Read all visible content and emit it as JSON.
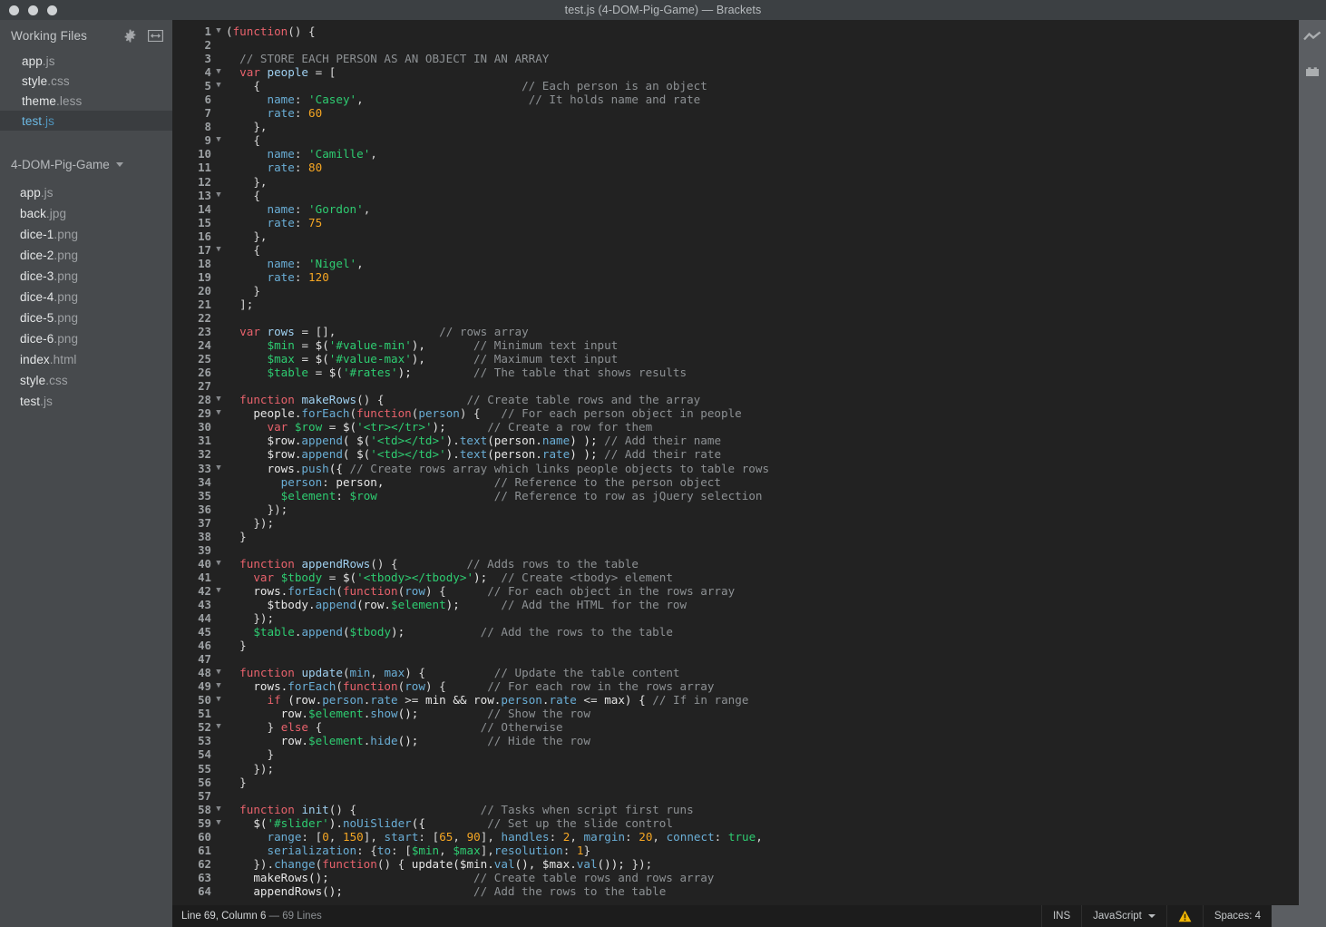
{
  "window": {
    "title": "test.js (4-DOM-Pig-Game) — Brackets",
    "traffic_lights": [
      "close",
      "minimize",
      "maximize"
    ]
  },
  "sidebar": {
    "working_files": {
      "title": "Working Files",
      "gear_icon": "gear-icon",
      "split_icon": "split-view-icon",
      "items": [
        {
          "base": "app",
          "ext": ".js",
          "active": false
        },
        {
          "base": "style",
          "ext": ".css",
          "active": false
        },
        {
          "base": "theme",
          "ext": ".less",
          "active": false
        },
        {
          "base": "test",
          "ext": ".js",
          "active": true
        }
      ]
    },
    "project": {
      "name": "4-DOM-Pig-Game",
      "items": [
        {
          "base": "app",
          "ext": ".js"
        },
        {
          "base": "back",
          "ext": ".jpg"
        },
        {
          "base": "dice-1",
          "ext": ".png"
        },
        {
          "base": "dice-2",
          "ext": ".png"
        },
        {
          "base": "dice-3",
          "ext": ".png"
        },
        {
          "base": "dice-4",
          "ext": ".png"
        },
        {
          "base": "dice-5",
          "ext": ".png"
        },
        {
          "base": "dice-6",
          "ext": ".png"
        },
        {
          "base": "index",
          "ext": ".html"
        },
        {
          "base": "style",
          "ext": ".css"
        },
        {
          "base": "test",
          "ext": ".js"
        }
      ]
    }
  },
  "right_toolbar": {
    "items": [
      {
        "icon": "live-preview-icon"
      },
      {
        "icon": "extension-manager-icon"
      }
    ]
  },
  "statusbar": {
    "cursor": "Line 69, Column 6",
    "lines": "— 69 Lines",
    "insert_mode": "INS",
    "language": "JavaScript",
    "problems_icon": "warning-triangle-icon",
    "indent": "Spaces: 4"
  },
  "colors": {
    "titlebar": "#3c4043",
    "sidebar": "#474a4d",
    "editor_bg": "#222222",
    "statusbar": "#1c1c1c",
    "toolbar": "#5b5e62",
    "accent_active_file": "#6cb9e3",
    "keyword": "#e8626c",
    "string": "#2ecc71",
    "number": "#f5a623",
    "comment": "#8d9194",
    "variable": "#6aaed6",
    "warning": "#f2b705"
  },
  "editor": {
    "filename": "test.js",
    "language": "javascript",
    "lines": [
      {
        "n": 1,
        "fold": true,
        "html": "<span class=\"pun\">(</span><span class=\"kw\">function</span><span class=\"pun\">() {</span>"
      },
      {
        "n": 2,
        "fold": false,
        "html": ""
      },
      {
        "n": 3,
        "fold": false,
        "html": "  <span class=\"com\">// STORE EACH PERSON AS AN OBJECT IN AN ARRAY</span>"
      },
      {
        "n": 4,
        "fold": true,
        "html": "  <span class=\"kw\">var</span> <span class=\"def\">people</span> <span class=\"pun\">= [</span>"
      },
      {
        "n": 5,
        "fold": true,
        "html": "    <span class=\"pun\">{</span>                                      <span class=\"com\">// Each person is an object</span>"
      },
      {
        "n": 6,
        "fold": false,
        "html": "      <span class=\"prop\">name</span><span class=\"pun\">:</span> <span class=\"str\">'Casey'</span><span class=\"pun\">,</span>                        <span class=\"com\">// It holds name and rate</span>"
      },
      {
        "n": 7,
        "fold": false,
        "html": "      <span class=\"prop\">rate</span><span class=\"pun\">:</span> <span class=\"num\">60</span>"
      },
      {
        "n": 8,
        "fold": false,
        "html": "    <span class=\"pun\">},</span>"
      },
      {
        "n": 9,
        "fold": true,
        "html": "    <span class=\"pun\">{</span>"
      },
      {
        "n": 10,
        "fold": false,
        "html": "      <span class=\"prop\">name</span><span class=\"pun\">:</span> <span class=\"str\">'Camille'</span><span class=\"pun\">,</span>"
      },
      {
        "n": 11,
        "fold": false,
        "html": "      <span class=\"prop\">rate</span><span class=\"pun\">:</span> <span class=\"num\">80</span>"
      },
      {
        "n": 12,
        "fold": false,
        "html": "    <span class=\"pun\">},</span>"
      },
      {
        "n": 13,
        "fold": true,
        "html": "    <span class=\"pun\">{</span>"
      },
      {
        "n": 14,
        "fold": false,
        "html": "      <span class=\"prop\">name</span><span class=\"pun\">:</span> <span class=\"str\">'Gordon'</span><span class=\"pun\">,</span>"
      },
      {
        "n": 15,
        "fold": false,
        "html": "      <span class=\"prop\">rate</span><span class=\"pun\">:</span> <span class=\"num\">75</span>"
      },
      {
        "n": 16,
        "fold": false,
        "html": "    <span class=\"pun\">},</span>"
      },
      {
        "n": 17,
        "fold": true,
        "html": "    <span class=\"pun\">{</span>"
      },
      {
        "n": 18,
        "fold": false,
        "html": "      <span class=\"prop\">name</span><span class=\"pun\">:</span> <span class=\"str\">'Nigel'</span><span class=\"pun\">,</span>"
      },
      {
        "n": 19,
        "fold": false,
        "html": "      <span class=\"prop\">rate</span><span class=\"pun\">:</span> <span class=\"num\">120</span>"
      },
      {
        "n": 20,
        "fold": false,
        "html": "    <span class=\"pun\">}</span>"
      },
      {
        "n": 21,
        "fold": false,
        "html": "  <span class=\"pun\">];</span>"
      },
      {
        "n": 22,
        "fold": false,
        "html": ""
      },
      {
        "n": 23,
        "fold": false,
        "html": "  <span class=\"kw\">var</span> <span class=\"def\">rows</span> <span class=\"pun\">= [],</span>               <span class=\"com\">// rows array</span>"
      },
      {
        "n": 24,
        "fold": false,
        "html": "      <span class=\"str\">$min</span> <span class=\"pun\">=</span> <span class=\"plain\">$(</span><span class=\"str\">'#value-min'</span><span class=\"plain\">),</span>       <span class=\"com\">// Minimum text input</span>"
      },
      {
        "n": 25,
        "fold": false,
        "html": "      <span class=\"str\">$max</span> <span class=\"pun\">=</span> <span class=\"plain\">$(</span><span class=\"str\">'#value-max'</span><span class=\"plain\">),</span>       <span class=\"com\">// Maximum text input</span>"
      },
      {
        "n": 26,
        "fold": false,
        "html": "      <span class=\"str\">$table</span> <span class=\"pun\">=</span> <span class=\"plain\">$(</span><span class=\"str\">'#rates'</span><span class=\"plain\">);</span>         <span class=\"com\">// The table that shows results</span>"
      },
      {
        "n": 27,
        "fold": false,
        "html": ""
      },
      {
        "n": 28,
        "fold": true,
        "html": "  <span class=\"kw\">function</span> <span class=\"def\">makeRows</span><span class=\"pun\">() {</span>            <span class=\"com\">// Create table rows and the array</span>"
      },
      {
        "n": 29,
        "fold": true,
        "html": "    <span class=\"plain\">people.</span><span class=\"var\">forEach</span><span class=\"pun\">(</span><span class=\"kw\">function</span><span class=\"pun\">(</span><span class=\"var\">person</span><span class=\"pun\">) {</span>   <span class=\"com\">// For each person object in people</span>"
      },
      {
        "n": 30,
        "fold": false,
        "html": "      <span class=\"kw\">var</span> <span class=\"str\">$row</span> <span class=\"pun\">=</span> <span class=\"plain\">$(</span><span class=\"str\">'&lt;tr&gt;&lt;/tr&gt;'</span><span class=\"plain\">);</span>      <span class=\"com\">// Create a row for them</span>"
      },
      {
        "n": 31,
        "fold": false,
        "html": "      <span class=\"plain\">$row.</span><span class=\"var\">append</span><span class=\"plain\">( $(</span><span class=\"str\">'&lt;td&gt;&lt;/td&gt;'</span><span class=\"plain\">).</span><span class=\"var\">text</span><span class=\"plain\">(person.</span><span class=\"var\">name</span><span class=\"plain\">) );</span> <span class=\"com\">// Add their name</span>"
      },
      {
        "n": 32,
        "fold": false,
        "html": "      <span class=\"plain\">$row.</span><span class=\"var\">append</span><span class=\"plain\">( $(</span><span class=\"str\">'&lt;td&gt;&lt;/td&gt;'</span><span class=\"plain\">).</span><span class=\"var\">text</span><span class=\"plain\">(person.</span><span class=\"var\">rate</span><span class=\"plain\">) );</span> <span class=\"com\">// Add their rate</span>"
      },
      {
        "n": 33,
        "fold": true,
        "html": "      <span class=\"plain\">rows.</span><span class=\"var\">push</span><span class=\"plain\">({</span> <span class=\"com\">// Create rows array which links people objects to table rows</span>"
      },
      {
        "n": 34,
        "fold": false,
        "html": "        <span class=\"prop\">person</span><span class=\"pun\">:</span> <span class=\"plain\">person,</span>                <span class=\"com\">// Reference to the person object</span>"
      },
      {
        "n": 35,
        "fold": false,
        "html": "        <span class=\"str\">$element</span><span class=\"pun\">:</span> <span class=\"str\">$row</span>                 <span class=\"com\">// Reference to row as jQuery selection</span>"
      },
      {
        "n": 36,
        "fold": false,
        "html": "      <span class=\"pun\">});</span>"
      },
      {
        "n": 37,
        "fold": false,
        "html": "    <span class=\"pun\">});</span>"
      },
      {
        "n": 38,
        "fold": false,
        "html": "  <span class=\"pun\">}</span>"
      },
      {
        "n": 39,
        "fold": false,
        "html": ""
      },
      {
        "n": 40,
        "fold": true,
        "html": "  <span class=\"kw\">function</span> <span class=\"def\">appendRows</span><span class=\"pun\">() {</span>          <span class=\"com\">// Adds rows to the table</span>"
      },
      {
        "n": 41,
        "fold": false,
        "html": "    <span class=\"kw\">var</span> <span class=\"str\">$tbody</span> <span class=\"pun\">=</span> <span class=\"plain\">$(</span><span class=\"str\">'&lt;tbody&gt;&lt;/tbody&gt;'</span><span class=\"plain\">);</span>  <span class=\"com\">// Create &lt;tbody&gt; element</span>"
      },
      {
        "n": 42,
        "fold": true,
        "html": "    <span class=\"plain\">rows.</span><span class=\"var\">forEach</span><span class=\"pun\">(</span><span class=\"kw\">function</span><span class=\"pun\">(</span><span class=\"var\">row</span><span class=\"pun\">) {</span>      <span class=\"com\">// For each object in the rows array</span>"
      },
      {
        "n": 43,
        "fold": false,
        "html": "      <span class=\"plain\">$tbody.</span><span class=\"var\">append</span><span class=\"plain\">(row.</span><span class=\"str\">$element</span><span class=\"plain\">);</span>      <span class=\"com\">// Add the HTML for the row</span>"
      },
      {
        "n": 44,
        "fold": false,
        "html": "    <span class=\"pun\">});</span>"
      },
      {
        "n": 45,
        "fold": false,
        "html": "    <span class=\"str\">$table</span><span class=\"plain\">.</span><span class=\"var\">append</span><span class=\"plain\">(</span><span class=\"str\">$tbody</span><span class=\"plain\">);</span>           <span class=\"com\">// Add the rows to the table</span>"
      },
      {
        "n": 46,
        "fold": false,
        "html": "  <span class=\"pun\">}</span>"
      },
      {
        "n": 47,
        "fold": false,
        "html": ""
      },
      {
        "n": 48,
        "fold": true,
        "html": "  <span class=\"kw\">function</span> <span class=\"def\">update</span><span class=\"pun\">(</span><span class=\"var\">min</span><span class=\"pun\">,</span> <span class=\"var\">max</span><span class=\"pun\">) {</span>          <span class=\"com\">// Update the table content</span>"
      },
      {
        "n": 49,
        "fold": true,
        "html": "    <span class=\"plain\">rows.</span><span class=\"var\">forEach</span><span class=\"pun\">(</span><span class=\"kw\">function</span><span class=\"pun\">(</span><span class=\"var\">row</span><span class=\"pun\">) {</span>      <span class=\"com\">// For each row in the rows array</span>"
      },
      {
        "n": 50,
        "fold": true,
        "html": "      <span class=\"kw\">if</span> <span class=\"plain\">(row.</span><span class=\"var\">person</span><span class=\"plain\">.</span><span class=\"var\">rate</span> <span class=\"pun\">&gt;=</span> <span class=\"plain\">min &amp;&amp; row.</span><span class=\"var\">person</span><span class=\"plain\">.</span><span class=\"var\">rate</span> <span class=\"pun\">&lt;=</span> <span class=\"plain\">max) {</span> <span class=\"com\">// If in range</span>"
      },
      {
        "n": 51,
        "fold": false,
        "html": "        <span class=\"plain\">row.</span><span class=\"str\">$element</span><span class=\"plain\">.</span><span class=\"var\">show</span><span class=\"plain\">();</span>          <span class=\"com\">// Show the row</span>"
      },
      {
        "n": 52,
        "fold": true,
        "html": "      <span class=\"pun\">}</span> <span class=\"kw\">else</span> <span class=\"pun\">{</span>                       <span class=\"com\">// Otherwise</span>"
      },
      {
        "n": 53,
        "fold": false,
        "html": "        <span class=\"plain\">row.</span><span class=\"str\">$element</span><span class=\"plain\">.</span><span class=\"var\">hide</span><span class=\"plain\">();</span>          <span class=\"com\">// Hide the row</span>"
      },
      {
        "n": 54,
        "fold": false,
        "html": "      <span class=\"pun\">}</span>"
      },
      {
        "n": 55,
        "fold": false,
        "html": "    <span class=\"pun\">});</span>"
      },
      {
        "n": 56,
        "fold": false,
        "html": "  <span class=\"pun\">}</span>"
      },
      {
        "n": 57,
        "fold": false,
        "html": ""
      },
      {
        "n": 58,
        "fold": true,
        "html": "  <span class=\"kw\">function</span> <span class=\"def\">init</span><span class=\"pun\">() {</span>                  <span class=\"com\">// Tasks when script first runs</span>"
      },
      {
        "n": 59,
        "fold": true,
        "html": "    <span class=\"plain\">$(</span><span class=\"str\">'#slider'</span><span class=\"plain\">).</span><span class=\"var\">noUiSlider</span><span class=\"plain\">({</span>         <span class=\"com\">// Set up the slide control</span>"
      },
      {
        "n": 60,
        "fold": false,
        "html": "      <span class=\"prop\">range</span><span class=\"pun\">:</span> <span class=\"pun\">[</span><span class=\"num\">0</span><span class=\"pun\">,</span> <span class=\"num\">150</span><span class=\"pun\">],</span> <span class=\"prop\">start</span><span class=\"pun\">:</span> <span class=\"pun\">[</span><span class=\"num\">65</span><span class=\"pun\">,</span> <span class=\"num\">90</span><span class=\"pun\">],</span> <span class=\"prop\">handles</span><span class=\"pun\">:</span> <span class=\"num\">2</span><span class=\"pun\">,</span> <span class=\"prop\">margin</span><span class=\"pun\">:</span> <span class=\"num\">20</span><span class=\"pun\">,</span> <span class=\"prop\">connect</span><span class=\"pun\">:</span> <span class=\"atom\">true</span><span class=\"pun\">,</span>"
      },
      {
        "n": 61,
        "fold": false,
        "html": "      <span class=\"prop\">serialization</span><span class=\"pun\">:</span> <span class=\"pun\">{</span><span class=\"prop\">to</span><span class=\"pun\">:</span> <span class=\"pun\">[</span><span class=\"str\">$min</span><span class=\"pun\">,</span> <span class=\"str\">$max</span><span class=\"pun\">],</span><span class=\"prop\">resolution</span><span class=\"pun\">:</span> <span class=\"num\">1</span><span class=\"pun\">}</span>"
      },
      {
        "n": 62,
        "fold": false,
        "html": "    <span class=\"pun\">}).</span><span class=\"var\">change</span><span class=\"pun\">(</span><span class=\"kw\">function</span><span class=\"pun\">() {</span> <span class=\"plain\">update($min.</span><span class=\"var\">val</span><span class=\"plain\">(), $max.</span><span class=\"var\">val</span><span class=\"plain\">());</span> <span class=\"pun\">});</span>"
      },
      {
        "n": 63,
        "fold": false,
        "html": "    <span class=\"plain\">makeRows();</span>                     <span class=\"com\">// Create table rows and rows array</span>"
      },
      {
        "n": 64,
        "fold": false,
        "html": "    <span class=\"plain\">appendRows();</span>                   <span class=\"com\">// Add the rows to the table</span>"
      }
    ]
  }
}
